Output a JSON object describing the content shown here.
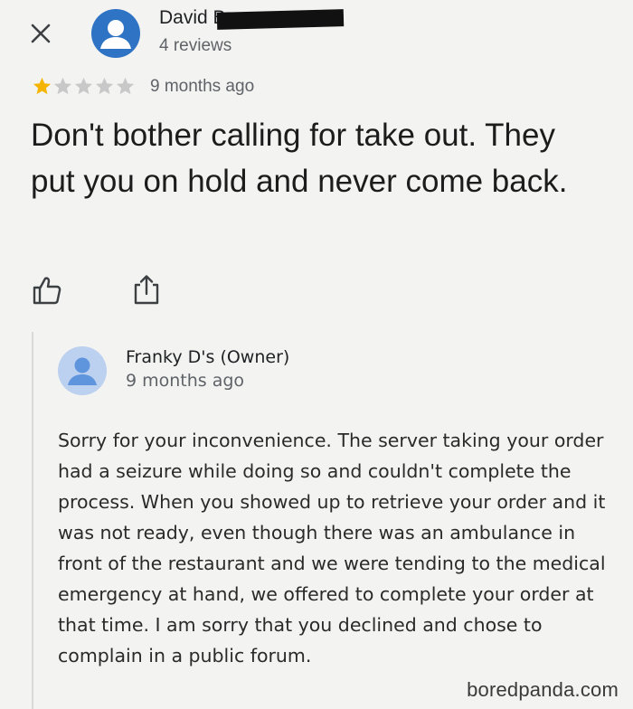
{
  "header": {
    "close_label": "Close",
    "reviewer_name": "David B",
    "review_count": "4 reviews"
  },
  "review": {
    "rating": 1,
    "max_rating": 5,
    "time": "9 months ago",
    "text": "Don't bother calling for take out. They put you on hold and never come back."
  },
  "actions": {
    "like_icon": "thumbs-up-icon",
    "share_icon": "share-icon"
  },
  "owner_reply": {
    "name": "Franky D's (Owner)",
    "time": "9 months ago",
    "text": "Sorry for your inconvenience.  The server taking your order had a seizure while doing so and couldn't complete the process.  When you showed up to retrieve your order and it was not ready, even though there was an ambulance in front of the restaurant and we were tending to the medical emergency at hand, we offered to complete your order at that time.  I am sorry that you declined and chose to complain in a public forum."
  },
  "watermark": "boredpanda.com",
  "colors": {
    "background": "#f3f4f2",
    "reviewer_avatar": "#2f73c4",
    "owner_avatar": "#bcd0ef",
    "star_filled": "#f4b400",
    "star_empty": "#c8c8c8",
    "icon": "#3c4043"
  }
}
